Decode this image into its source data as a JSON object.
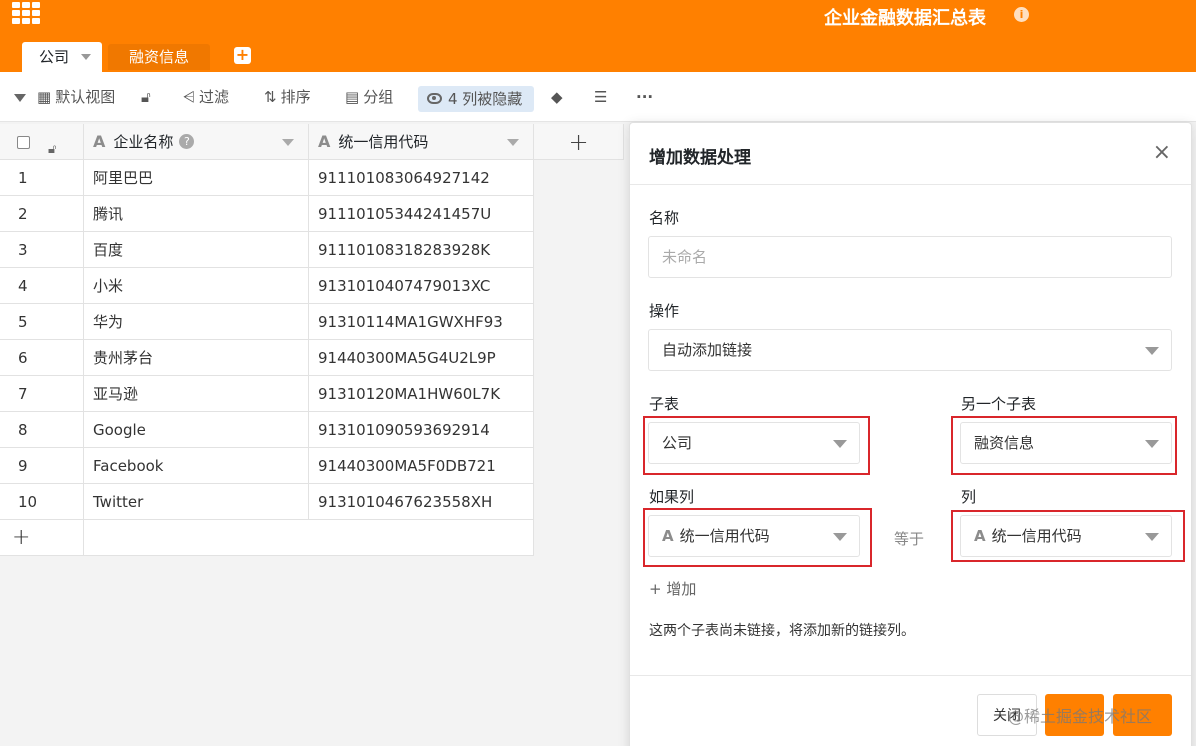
{
  "header": {
    "title": "企业金融数据汇总表",
    "info_glyph": "i",
    "tabs": [
      {
        "label": "公司",
        "active": true
      },
      {
        "label": "融资信息",
        "active": false
      }
    ],
    "add_tab_glyph": "+"
  },
  "toolbar": {
    "view": "默认视图",
    "filter": "过滤",
    "sort": "排序",
    "group": "分组",
    "hidden_columns": "4 列被隐藏",
    "more": "···"
  },
  "table": {
    "columns": [
      "企业名称",
      "统一信用代码"
    ],
    "add_column_glyph": "+",
    "add_row_glyph": "+",
    "rows": [
      {
        "num": "1",
        "name": "阿里巴巴",
        "code": "91110108306492714 2"
      },
      {
        "num": "2",
        "name": "腾讯",
        "code": "91110105344241457U"
      },
      {
        "num": "3",
        "name": "百度",
        "code": "91110108318283928K"
      },
      {
        "num": "4",
        "name": "小米",
        "code": "9131010407479013XC"
      },
      {
        "num": "5",
        "name": "华为",
        "code": "91310114MA1GWXHF93"
      },
      {
        "num": "6",
        "name": "贵州茅台",
        "code": "91440300MA5G4U2L9P"
      },
      {
        "num": "7",
        "name": "亚马逊",
        "code": "91310120MA1HW60L7K"
      },
      {
        "num": "8",
        "name": "Google",
        "code": "913101090593692914"
      },
      {
        "num": "9",
        "name": "Facebook",
        "code": "91440300MA5F0DB721"
      },
      {
        "num": "10",
        "name": "Twitter",
        "code": "9131010467623558XH"
      }
    ]
  },
  "dialog": {
    "title": "增加数据处理",
    "close_glyph": "×",
    "name_label": "名称",
    "name_placeholder": "未命名",
    "operation_label": "操作",
    "operation_value": "自动添加链接",
    "sub_table_label": "子表",
    "sub_table_value": "公司",
    "other_table_label": "另一个子表",
    "other_table_value": "融资信息",
    "if_column_label": "如果列",
    "if_column_value": "统一信用代码",
    "equals_label": "等于",
    "column_label": "列",
    "column_value": "统一信用代码",
    "add_label": "增加",
    "note": "这两个子表尚未链接，将添加新的链接列。",
    "close_button": "关闭"
  },
  "watermark": "@稀土掘金技术社区",
  "colors": {
    "brand": "#ff8000",
    "highlight": "#d9262b",
    "selected": "#dde9f6"
  }
}
